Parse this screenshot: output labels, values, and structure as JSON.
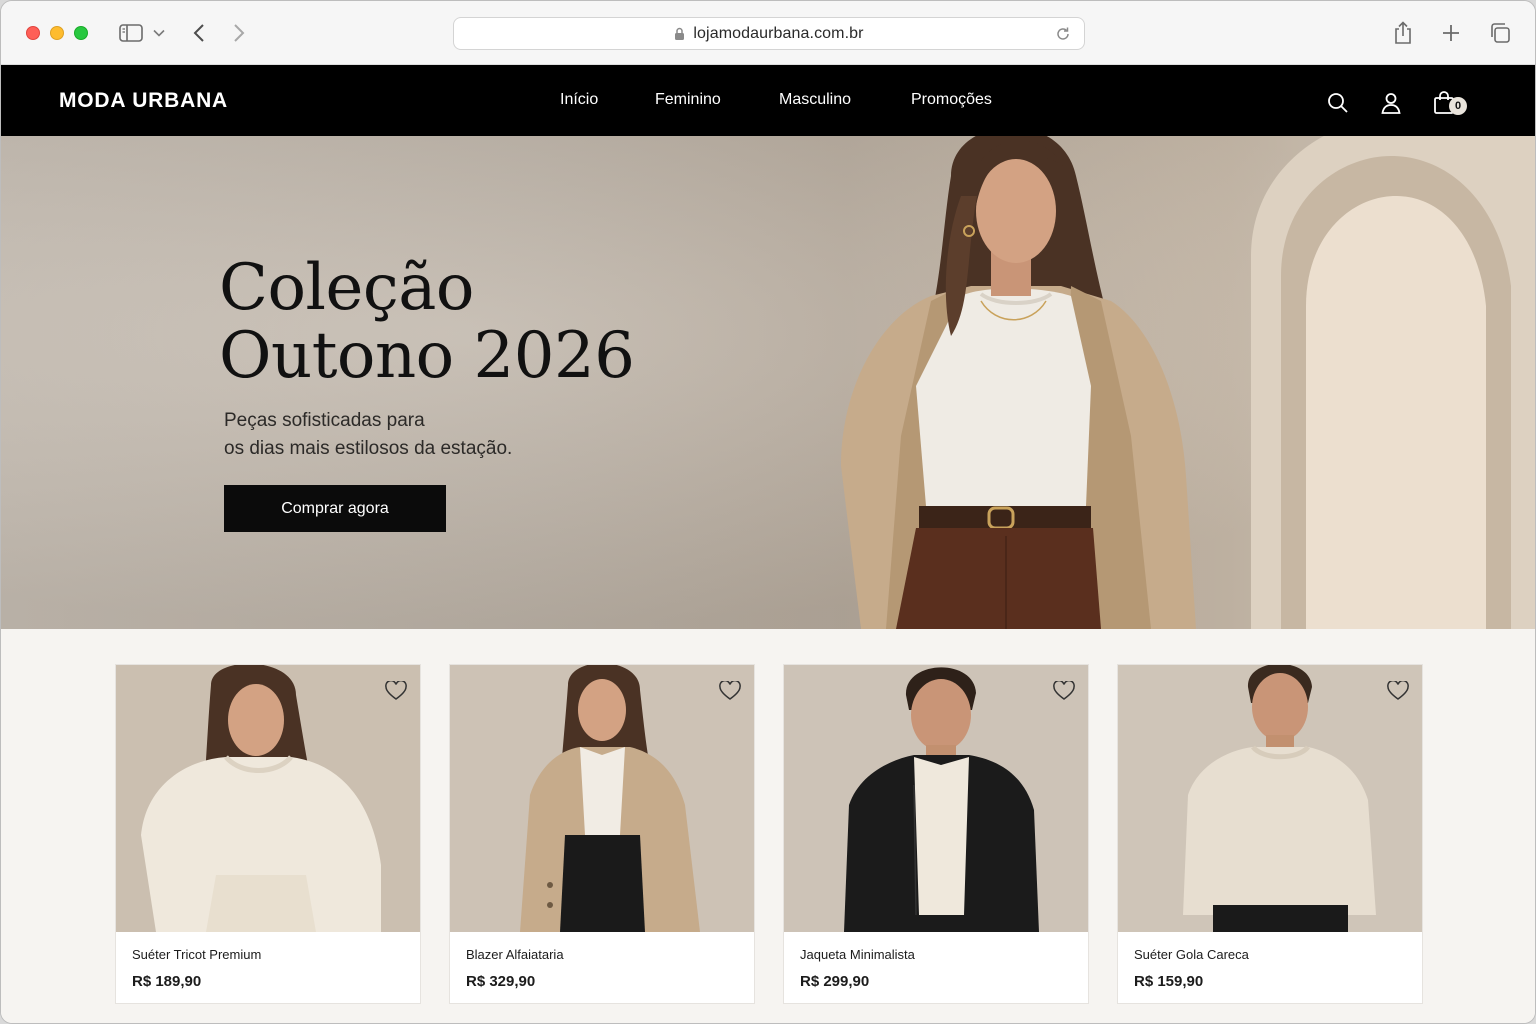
{
  "browser": {
    "url": "lojamodaurbana.com.br",
    "icons": [
      "sidebar-icon",
      "chevron-down-icon",
      "back-arrow-icon",
      "forward-arrow-icon",
      "lock-icon",
      "reload-icon",
      "share-icon",
      "plus-icon",
      "tabs-icon"
    ]
  },
  "header": {
    "logo": "MODA URBANA",
    "nav": [
      "Início",
      "Feminino",
      "Masculino",
      "Promoções"
    ],
    "cart_count": "0",
    "icons": [
      "search-icon",
      "user-icon",
      "shopping-bag-icon"
    ]
  },
  "hero": {
    "title_line1": "Coleção",
    "title_line2": "Outono 2026",
    "subtitle_line1": "Peças sofisticadas para",
    "subtitle_line2": "os dias mais estilosos da estação.",
    "cta": "Comprar agora"
  },
  "products": [
    {
      "name": "Suéter Tricot Premium",
      "price": "R$ 189,90"
    },
    {
      "name": "Blazer Alfaiataria",
      "price": "R$ 329,90"
    },
    {
      "name": "Jaqueta Minimalista",
      "price": "R$ 299,90"
    },
    {
      "name": "Suéter Gola Careca",
      "price": "R$ 159,90"
    }
  ],
  "colors": {
    "header_bg": "#000000",
    "cta_bg": "#0b0b0b",
    "page_bg": "#f6f4f1",
    "hero_bg": "#beb4a8"
  }
}
